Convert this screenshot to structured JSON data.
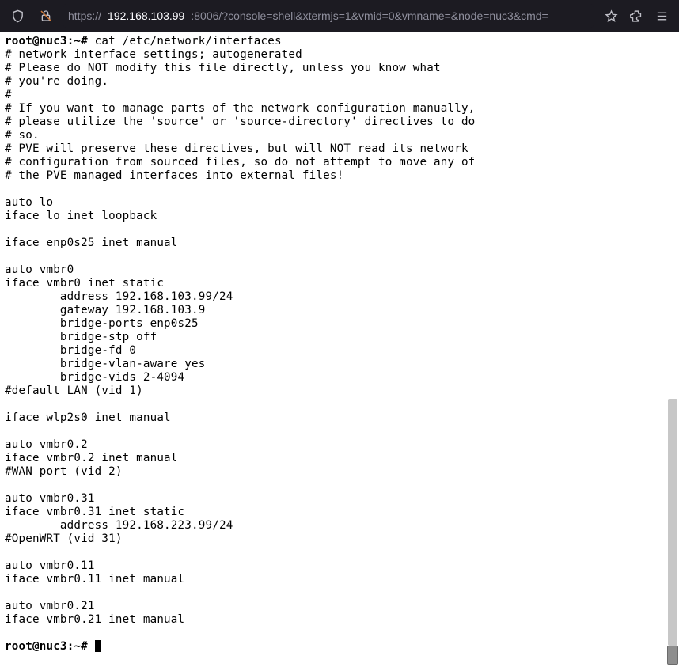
{
  "address_bar": {
    "protocol": "https://",
    "host": "192.168.103.99",
    "rest": ":8006/?console=shell&xtermjs=1&vmid=0&vmname=&node=nuc3&cmd="
  },
  "terminal": {
    "prompt1_user": "root@nuc3",
    "prompt1_suffix": ":~# ",
    "command": "cat /etc/network/interfaces",
    "body": "# network interface settings; autogenerated\n# Please do NOT modify this file directly, unless you know what\n# you're doing.\n#\n# If you want to manage parts of the network configuration manually,\n# please utilize the 'source' or 'source-directory' directives to do\n# so.\n# PVE will preserve these directives, but will NOT read its network\n# configuration from sourced files, so do not attempt to move any of\n# the PVE managed interfaces into external files!\n\nauto lo\niface lo inet loopback\n\niface enp0s25 inet manual\n\nauto vmbr0\niface vmbr0 inet static\n        address 192.168.103.99/24\n        gateway 192.168.103.9\n        bridge-ports enp0s25\n        bridge-stp off\n        bridge-fd 0\n        bridge-vlan-aware yes\n        bridge-vids 2-4094\n#default LAN (vid 1)\n\niface wlp2s0 inet manual\n\nauto vmbr0.2\niface vmbr0.2 inet manual\n#WAN port (vid 2)\n\nauto vmbr0.31\niface vmbr0.31 inet static\n        address 192.168.223.99/24\n#OpenWRT (vid 31)\n\nauto vmbr0.11\niface vmbr0.11 inet manual\n\nauto vmbr0.21\niface vmbr0.21 inet manual\n",
    "prompt2_user": "root@nuc3",
    "prompt2_suffix": ":~# "
  }
}
